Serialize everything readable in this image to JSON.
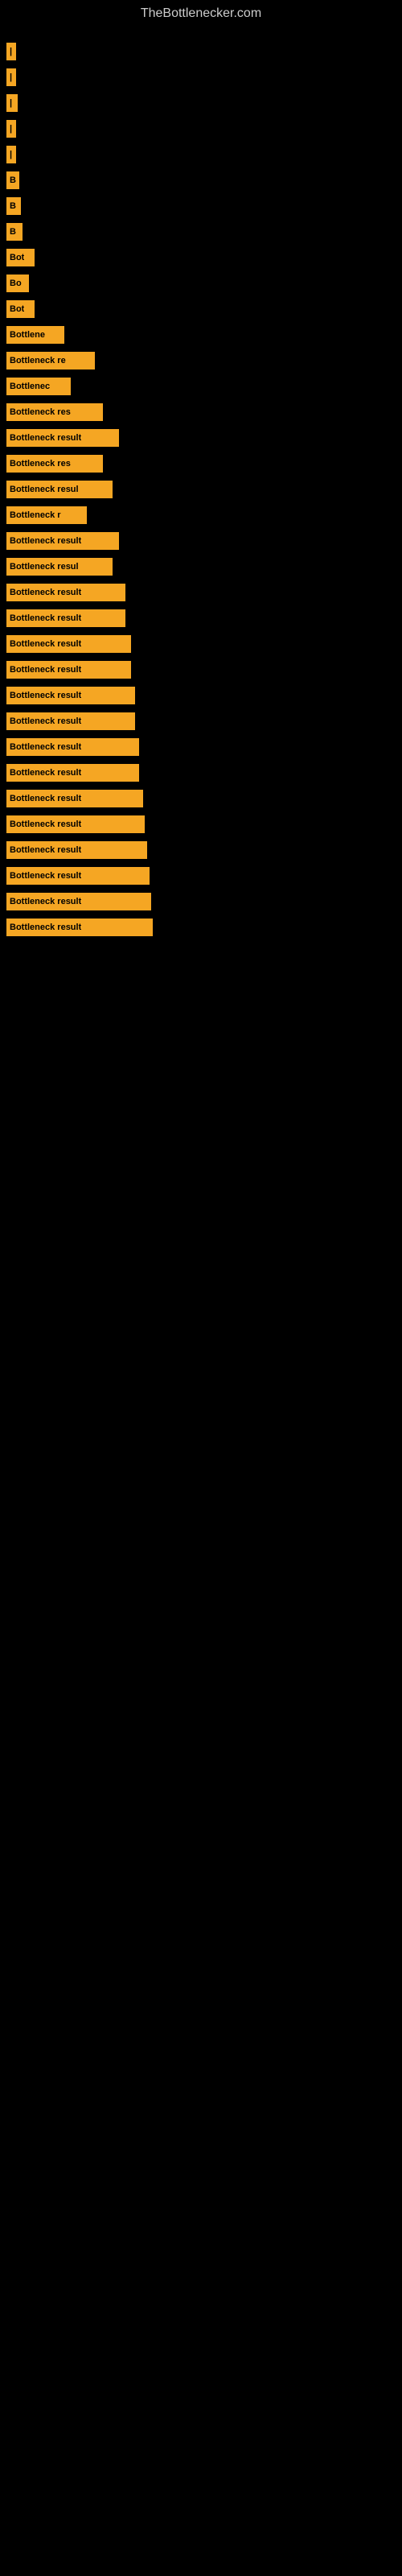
{
  "site": {
    "title": "TheBottlenecker.com"
  },
  "bars": [
    {
      "id": 1,
      "label": "|",
      "width": 12
    },
    {
      "id": 2,
      "label": "|",
      "width": 12
    },
    {
      "id": 3,
      "label": "|",
      "width": 14
    },
    {
      "id": 4,
      "label": "|",
      "width": 12
    },
    {
      "id": 5,
      "label": "|",
      "width": 12
    },
    {
      "id": 6,
      "label": "B",
      "width": 16
    },
    {
      "id": 7,
      "label": "B",
      "width": 18
    },
    {
      "id": 8,
      "label": "B",
      "width": 20
    },
    {
      "id": 9,
      "label": "Bot",
      "width": 35
    },
    {
      "id": 10,
      "label": "Bo",
      "width": 28
    },
    {
      "id": 11,
      "label": "Bot",
      "width": 35
    },
    {
      "id": 12,
      "label": "Bottlene",
      "width": 72
    },
    {
      "id": 13,
      "label": "Bottleneck re",
      "width": 110
    },
    {
      "id": 14,
      "label": "Bottlenec",
      "width": 80
    },
    {
      "id": 15,
      "label": "Bottleneck res",
      "width": 120
    },
    {
      "id": 16,
      "label": "Bottleneck result",
      "width": 140
    },
    {
      "id": 17,
      "label": "Bottleneck res",
      "width": 120
    },
    {
      "id": 18,
      "label": "Bottleneck resul",
      "width": 132
    },
    {
      "id": 19,
      "label": "Bottleneck r",
      "width": 100
    },
    {
      "id": 20,
      "label": "Bottleneck result",
      "width": 140
    },
    {
      "id": 21,
      "label": "Bottleneck resul",
      "width": 132
    },
    {
      "id": 22,
      "label": "Bottleneck result",
      "width": 148
    },
    {
      "id": 23,
      "label": "Bottleneck result",
      "width": 148
    },
    {
      "id": 24,
      "label": "Bottleneck result",
      "width": 155
    },
    {
      "id": 25,
      "label": "Bottleneck result",
      "width": 155
    },
    {
      "id": 26,
      "label": "Bottleneck result",
      "width": 160
    },
    {
      "id": 27,
      "label": "Bottleneck result",
      "width": 160
    },
    {
      "id": 28,
      "label": "Bottleneck result",
      "width": 165
    },
    {
      "id": 29,
      "label": "Bottleneck result",
      "width": 165
    },
    {
      "id": 30,
      "label": "Bottleneck result",
      "width": 170
    },
    {
      "id": 31,
      "label": "Bottleneck result",
      "width": 172
    },
    {
      "id": 32,
      "label": "Bottleneck result",
      "width": 175
    },
    {
      "id": 33,
      "label": "Bottleneck result",
      "width": 178
    },
    {
      "id": 34,
      "label": "Bottleneck result",
      "width": 180
    },
    {
      "id": 35,
      "label": "Bottleneck result",
      "width": 182
    }
  ]
}
